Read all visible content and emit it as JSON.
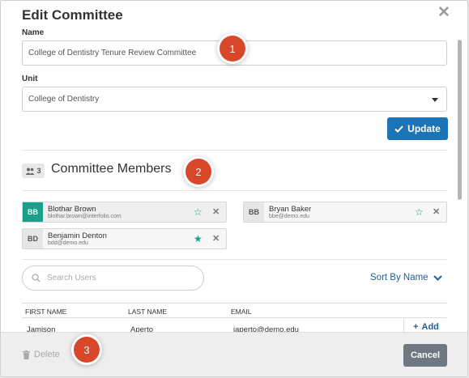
{
  "dialog": {
    "title": "Edit Committee"
  },
  "form": {
    "name_label": "Name",
    "name_value": "College of Dentistry Tenure Review Committee",
    "unit_label": "Unit",
    "unit_value": "College of Dentistry",
    "update_label": "Update"
  },
  "members_section": {
    "count": "3",
    "title": "Committee Members",
    "members": [
      {
        "initials": "BB",
        "name": "Blothar Brown",
        "email": "blothar.brown@interfolio.com",
        "starred": false,
        "avatar_color": "#19a08a"
      },
      {
        "initials": "BB",
        "name": "Bryan Baker",
        "email": "bbe@demo.edu",
        "starred": false,
        "avatar_color": "#e6e6e6"
      },
      {
        "initials": "BD",
        "name": "Benjamin Denton",
        "email": "bdd@demo.edu",
        "starred": true,
        "avatar_color": "#e6e6e6"
      }
    ]
  },
  "search": {
    "placeholder": "Search Users",
    "sort_label": "Sort By Name"
  },
  "table": {
    "headers": [
      "FIRST NAME",
      "LAST NAME",
      "EMAIL"
    ],
    "rows": [
      {
        "first": "Jamison",
        "last": "Aperto",
        "email": "japerto@demo.edu",
        "action": "Add"
      }
    ]
  },
  "footer": {
    "delete_label": "Delete",
    "cancel_label": "Cancel"
  },
  "callouts": [
    "1",
    "2",
    "3"
  ],
  "colors": {
    "accent": "#1d74b4",
    "teal": "#19a08a",
    "callout": "#d9472b",
    "cancel": "#6f7780"
  }
}
